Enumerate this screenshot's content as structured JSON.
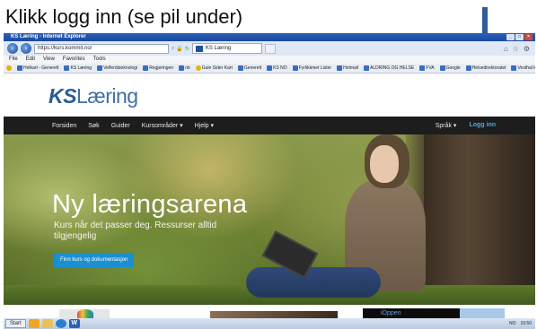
{
  "instruction": {
    "text": "Klikk logg inn (se pil under)"
  },
  "browser": {
    "window_title": "KS Læring - Internet Explorer",
    "address": "https://kurs.kommit.no/",
    "tab_label": "KS Læring",
    "menu": [
      "File",
      "Edit",
      "View",
      "Favorites",
      "Tools"
    ],
    "favorites": [
      {
        "label": "Helkart - Generelt"
      },
      {
        "label": "KS Læring"
      },
      {
        "label": "Velferdsteknologi"
      },
      {
        "label": "Regjeringen"
      },
      {
        "label": "nb"
      },
      {
        "label": "Gule Sider Kart"
      },
      {
        "label": "Generelt"
      },
      {
        "label": "KS NO"
      },
      {
        "label": "Fyrlikkmet Lister"
      },
      {
        "label": "Hotmail"
      },
      {
        "label": "ALDRING OG HELSE"
      },
      {
        "label": "FVA"
      },
      {
        "label": "Google"
      },
      {
        "label": "Helsedirektoratet"
      },
      {
        "label": "Vesthal kommune - Hjem"
      }
    ]
  },
  "site": {
    "logo_ks": "KS",
    "logo_text": "Læring",
    "nav": {
      "items": [
        "Forsiden",
        "Søk",
        "Guider",
        "Kursområder ▾",
        "Hjelp ▾"
      ],
      "language": "Språk ▾",
      "login": "Logg inn"
    },
    "hero": {
      "title": "Ny læringsarena",
      "subtitle": "Kurs når det passer deg. Ressurser alltid tilgjengelig",
      "button": "Finn kurs og dokumentasjon"
    },
    "thumb3_text": "iOppen"
  },
  "taskbar": {
    "start": "Start",
    "clock": "10:50",
    "lang": "NO"
  },
  "colors": {
    "arrow": "#2e5b9a",
    "nav_bg": "#1d1d1d",
    "login_link": "#4aa8e8",
    "hero_button": "#1b8fd0",
    "logo": "#3f6fa3"
  }
}
